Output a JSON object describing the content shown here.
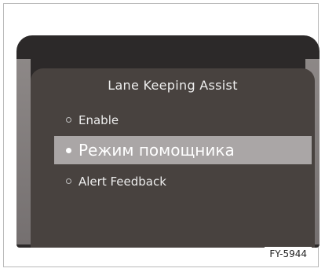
{
  "screen": {
    "title": "Lane Keeping Assist",
    "items": [
      {
        "label": "Enable",
        "selected": false
      },
      {
        "label": "Режим помощника",
        "selected": true
      },
      {
        "label": "Alert Feedback",
        "selected": false
      }
    ]
  },
  "figure_code": "FY-5944",
  "colors": {
    "screen_bg": "#48423f",
    "highlight": "#aaa6a6",
    "bezel": "#2c2929"
  }
}
